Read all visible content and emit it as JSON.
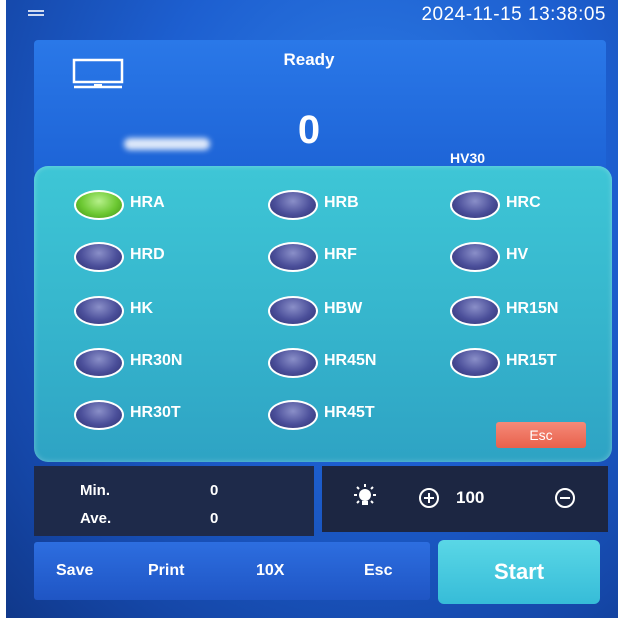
{
  "header": {
    "datetime": "2024-11-15 13:38:05"
  },
  "display": {
    "status": "Ready",
    "reading": "0",
    "scale": "HV30"
  },
  "scales": [
    {
      "label": "HRA",
      "selected": true
    },
    {
      "label": "HRB",
      "selected": false
    },
    {
      "label": "HRC",
      "selected": false
    },
    {
      "label": "HRD",
      "selected": false
    },
    {
      "label": "HRF",
      "selected": false
    },
    {
      "label": "HV",
      "selected": false
    },
    {
      "label": "HK",
      "selected": false
    },
    {
      "label": "HBW",
      "selected": false
    },
    {
      "label": "HR15N",
      "selected": false
    },
    {
      "label": "HR30N",
      "selected": false
    },
    {
      "label": "HR45N",
      "selected": false
    },
    {
      "label": "HR15T",
      "selected": false
    },
    {
      "label": "HR30T",
      "selected": false
    },
    {
      "label": "HR45T",
      "selected": false
    }
  ],
  "scale_panel": {
    "esc_label": "Esc"
  },
  "stats": {
    "min_label": "Min.",
    "min_value": "0",
    "ave_label": "Ave.",
    "ave_value": "0"
  },
  "light": {
    "value": "100"
  },
  "bottom": {
    "save": "Save",
    "print": "Print",
    "zoom": "10X",
    "esc": "Esc",
    "start": "Start"
  },
  "colors": {
    "selected": "#6cc832",
    "panel": "#36b6cd",
    "esc": "#e8614c"
  }
}
